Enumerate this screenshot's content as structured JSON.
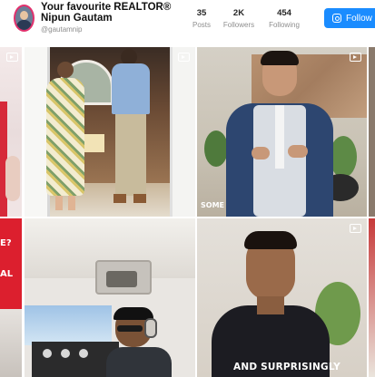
{
  "profile": {
    "name": "Your favourite REALTOR® Nipun Gautam",
    "handle": "@gautamnip"
  },
  "stats": [
    {
      "count": "35",
      "label": "Posts"
    },
    {
      "count": "2K",
      "label": "Followers"
    },
    {
      "count": "454",
      "label": "Following"
    }
  ],
  "follow_button": {
    "label": "Follow",
    "color": "#1a8cff"
  },
  "tiles": {
    "mid_right_caption": "SOME",
    "bottom_right_caption": "AND SURPRISINGLY",
    "left_edge_caption_1": "E?",
    "left_edge_caption_2": "AL"
  },
  "icons": [
    "instagram-icon",
    "reel-icon"
  ]
}
